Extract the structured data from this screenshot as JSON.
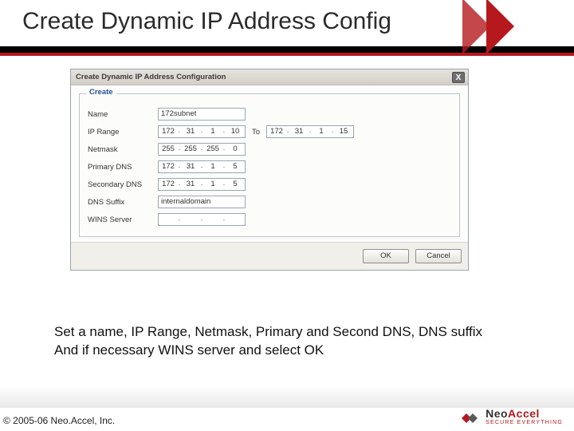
{
  "slide": {
    "title": "Create Dynamic IP Address Config",
    "caption_line1": "Set a name, IP Range, Netmask, Primary and Second DNS, DNS suffix",
    "caption_line2": "And if necessary WINS server and select OK",
    "copyright": "© 2005-06 Neo.Accel, Inc."
  },
  "logo": {
    "name_part1": "Neo",
    "name_part2": "Accel",
    "tagline": "SECURE EVERYTHING"
  },
  "dialog": {
    "title": "Create Dynamic IP Address Configuration",
    "legend": "Create",
    "labels": {
      "name": "Name",
      "ip_range": "IP Range",
      "to": "To",
      "netmask": "Netmask",
      "primary_dns": "Primary DNS",
      "secondary_dns": "Secondary DNS",
      "dns_suffix": "DNS Suffix",
      "wins_server": "WINS Server"
    },
    "values": {
      "name": "172subnet",
      "ip_from": {
        "o1": "172",
        "o2": "31",
        "o3": "1",
        "o4": "10"
      },
      "ip_to": {
        "o1": "172",
        "o2": "31",
        "o3": "1",
        "o4": "15"
      },
      "netmask": {
        "o1": "255",
        "o2": "255",
        "o3": "255",
        "o4": "0"
      },
      "primary_dns": {
        "o1": "172",
        "o2": "31",
        "o3": "1",
        "o4": "5"
      },
      "secondary_dns": {
        "o1": "172",
        "o2": "31",
        "o3": "1",
        "o4": "5"
      },
      "dns_suffix": "internaldomain",
      "wins": {
        "o1": "",
        "o2": "",
        "o3": "",
        "o4": ""
      }
    },
    "buttons": {
      "ok": "OK",
      "cancel": "Cancel"
    }
  }
}
